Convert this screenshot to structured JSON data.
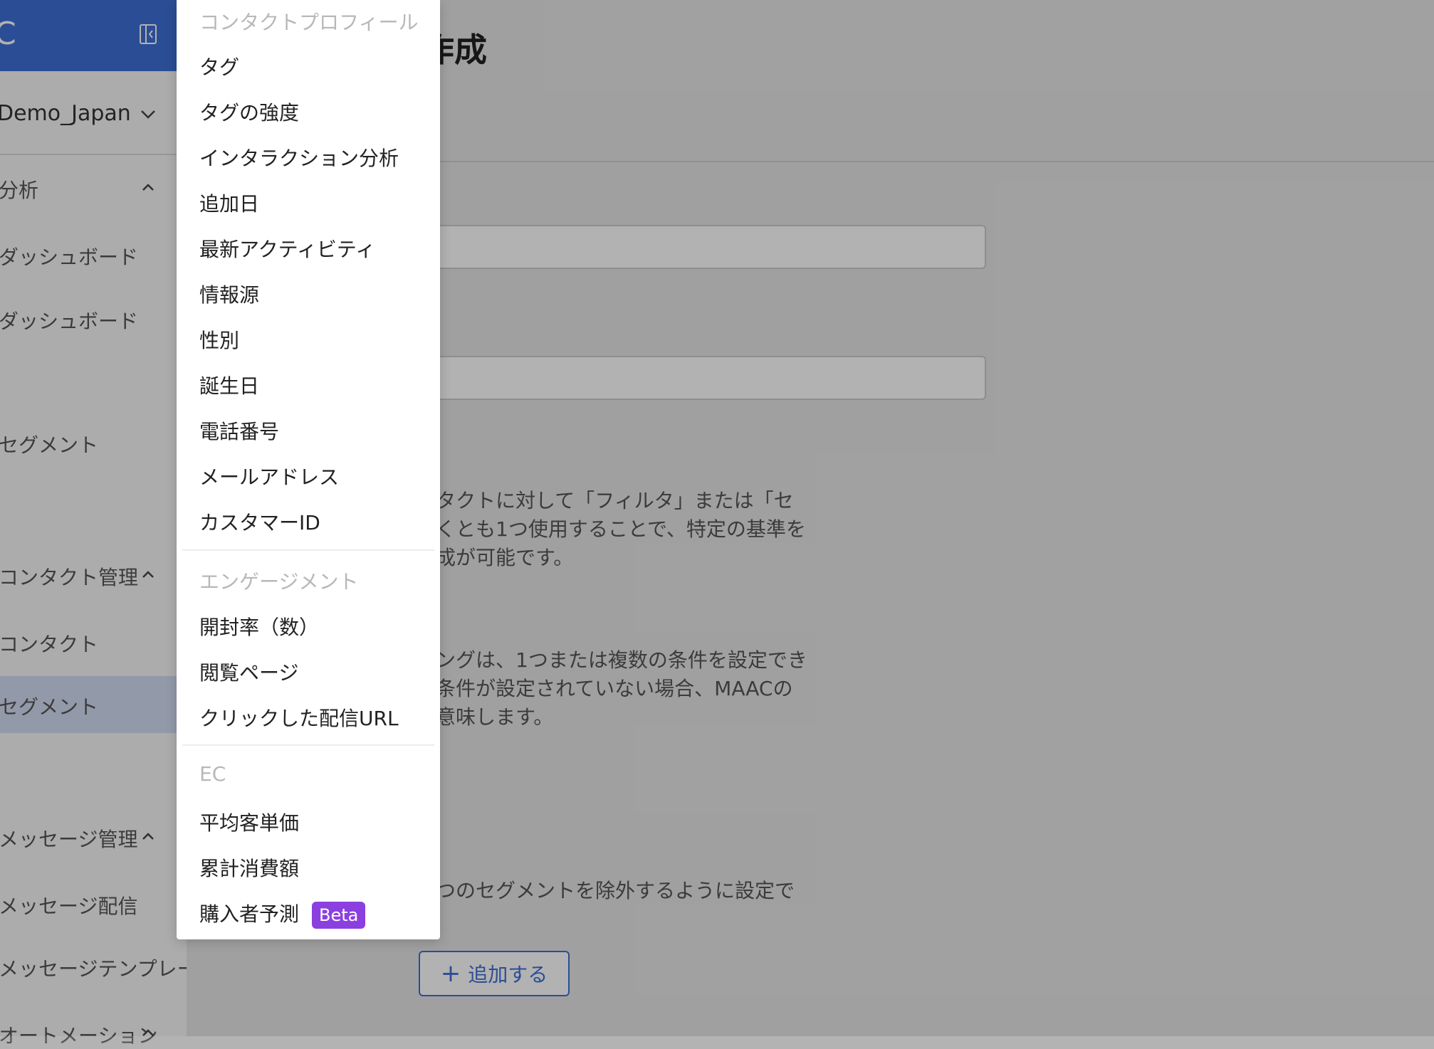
{
  "sidebar": {
    "account_name": "Demo_Japan",
    "brand_glyph": "C",
    "section_analysis": "分析",
    "item_dashboard": "ダッシュボード",
    "item_dashboard2": "ダッシュボード",
    "item_segment": "セグメント",
    "section_contact": "コンタクト管理",
    "item_contact": "コンタクト",
    "item_contact_selected": "セグメント",
    "section_message": "メッセージ管理",
    "item_broadcast": "メッセージ配信",
    "item_template": "メッセージテンプレート",
    "section_automation": "オートメーション"
  },
  "main": {
    "title_partial": "作成",
    "para1_lines": [
      "タクトに対して「フィルタ」または「セ",
      "くとも1つ使用することで、特定の基準を",
      "成が可能です。"
    ],
    "para2_lines": [
      "ングは、1つまたは複数の条件を設定でき",
      "条件が設定されていない場合、MAACの",
      "意味します。"
    ],
    "para3": "つのセグメントを除外するように設定で",
    "add_button_label": "追加する"
  },
  "dropdown": {
    "group_contact_profile": "コンタクトプロフィール",
    "items_contact": [
      "タグ",
      "タグの強度",
      "インタラクション分析",
      "追加日",
      "最新アクティビティ",
      "情報源",
      "性別",
      "誕生日",
      "電話番号",
      "メールアドレス",
      "カスタマーID"
    ],
    "group_engagement": "エンゲージメント",
    "items_engagement": [
      "開封率（数）",
      "閲覧ページ",
      "クリックした配信URL"
    ],
    "group_ec": "EC",
    "items_ec": [
      "平均客単価",
      "累計消費額",
      "購入者予測"
    ],
    "beta_badge": "Beta"
  },
  "colors": {
    "accent": "#3e6fd6",
    "beta": "#8b3fe0"
  }
}
